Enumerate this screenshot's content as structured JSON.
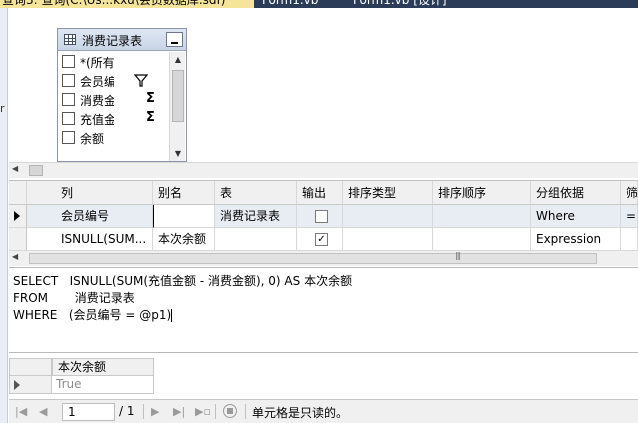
{
  "tabs": [
    {
      "label": "查询3: 查询(C:\\Us...kxu\\会员数据库.sdf)",
      "active": true
    },
    {
      "label": "Form1.vb",
      "active": false
    },
    {
      "label": "Form1.vb [设计]",
      "active": false
    }
  ],
  "diagram": {
    "table_title": "消费记录表",
    "columns": [
      {
        "label": "*(所有",
        "checked": false,
        "indicator": ""
      },
      {
        "label": "会员编",
        "checked": false,
        "indicator": "filter"
      },
      {
        "label": "消费金",
        "checked": false,
        "indicator": "Σ"
      },
      {
        "label": "充值金",
        "checked": false,
        "indicator": "Σ"
      },
      {
        "label": "余额",
        "checked": false,
        "indicator": ""
      }
    ]
  },
  "criteria": {
    "headers": [
      "列",
      "别名",
      "表",
      "输出",
      "排序类型",
      "排序顺序",
      "分组依据",
      "筛"
    ],
    "rows": [
      {
        "column": "会员编号",
        "alias": "",
        "table": "消费记录表",
        "output": false,
        "sort_type": "",
        "sort_order": "",
        "group_by": "Where",
        "filter": "="
      },
      {
        "column": "ISNULL(SUM...",
        "alias": "本次余额",
        "table": "",
        "output": true,
        "sort_type": "",
        "sort_order": "",
        "group_by": "Expression",
        "filter": ""
      }
    ]
  },
  "sql": {
    "line1": "SELECT   ISNULL(SUM(充值金额 - 消费金额), 0) AS 本次余额",
    "line2": "FROM       消费记录表",
    "line3": "WHERE   (会员编号 = @p1)"
  },
  "results": {
    "header": "本次余额",
    "value": "True"
  },
  "navigator": {
    "current_record": "1",
    "total": "/ 1",
    "status": "单元格是只读的。"
  }
}
